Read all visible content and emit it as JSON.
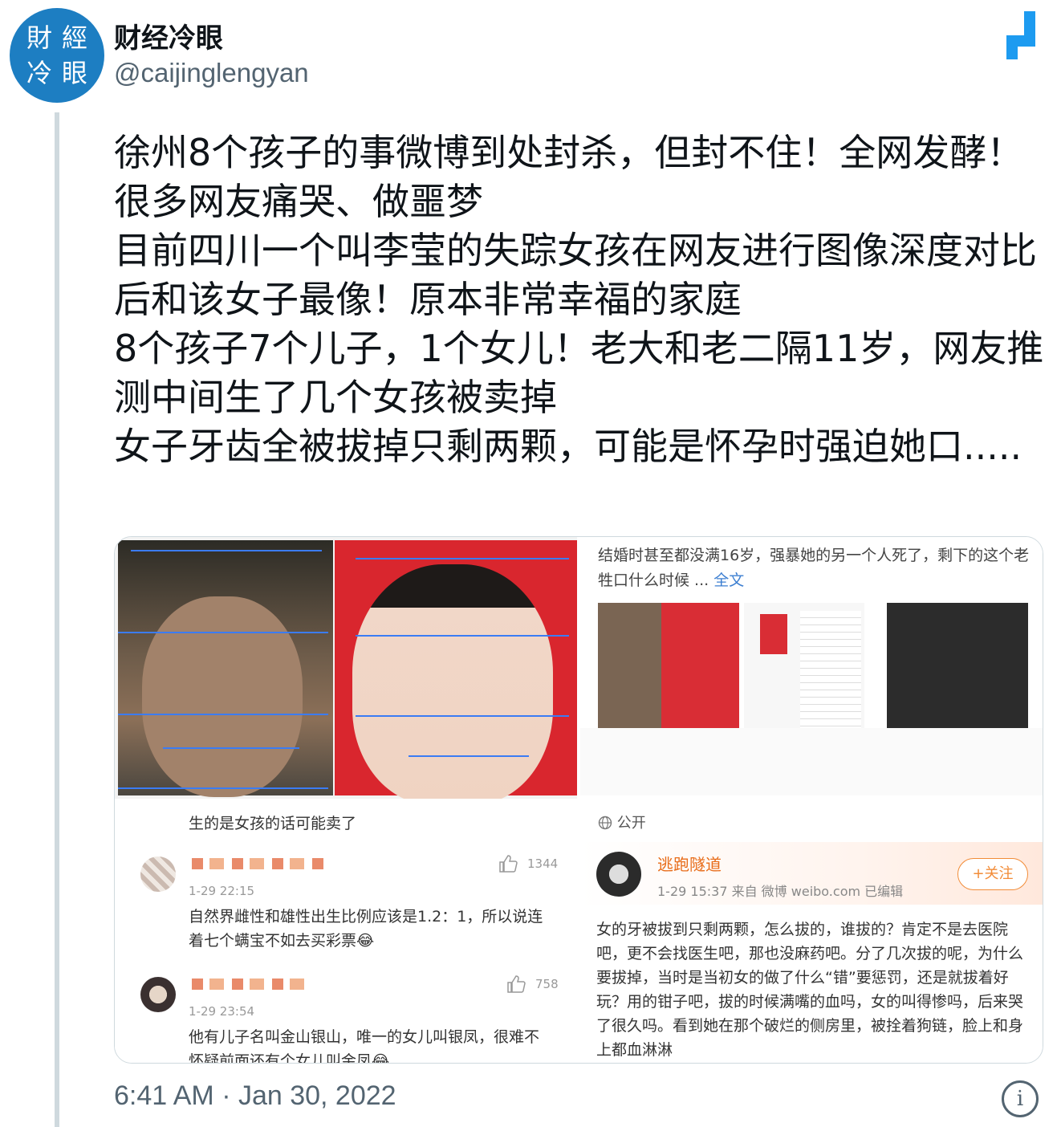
{
  "account": {
    "avatar_chars": [
      "財",
      "經",
      "冷",
      "眼"
    ],
    "display_name": "财经冷眼",
    "handle": "@caijinglengyan"
  },
  "tweet": {
    "lines": [
      "徐州8个孩子的事微博到处封杀，但封不住！全网发酵！很多网友痛哭、做噩梦",
      "目前四川一个叫李莹的失踪女孩在网友进行图像深度对比后和该女子最像！原本非常幸福的家庭",
      "8个孩子7个儿子，1个女儿！老大和老二隔11岁，网友推测中间生了几个女孩被卖掉",
      "女子牙齿全被拔掉只剩两颗，可能是怀孕时强迫她口....."
    ],
    "timestamp": "6:41 AM · Jan 30, 2022"
  },
  "media": {
    "left_comments": {
      "title": "生的是女孩的话可能卖了",
      "items": [
        {
          "time": "1-29 22:15",
          "likes": "1344",
          "text": "自然界雌性和雄性出生比例应该是1.2：1，所以说连着七个螨宝不如去买彩票😂"
        },
        {
          "time": "1-29 23:54",
          "likes": "758",
          "text": "他有儿子名叫金山银山，唯一的女儿叫银凤，很难不怀疑前面还有个女儿叫金凤😂"
        }
      ]
    },
    "right_top": {
      "text": "结婚时甚至都没满16岁，强暴她的另一个人死了，剩下的这个老牲口什么时候 ...",
      "more": "全文",
      "public_label": "公开"
    },
    "right_bottom": {
      "user": "逃跑隧道",
      "meta": "1-29 15:37  来自 微博 weibo.com  已编辑",
      "follow": "+关注",
      "text": "女的牙被拔到只剩两颗，怎么拔的，谁拔的？肯定不是去医院吧，更不会找医生吧，那也没麻药吧。分了几次拔的呢，为什么要拔掉，当时是当初女的做了什么“错”要惩罚，还是就拔着好玩？用的钳子吧，拔的时候满嘴的血吗，女的叫得惨吗，后来哭了很久吗。看到她在那个破烂的侧房里，被拴着狗链，脸上和身上都血淋淋"
    }
  },
  "icons": {
    "logo": "blog-logo-icon",
    "info": "info-icon",
    "like": "thumbs-up-icon",
    "globe": "globe-icon"
  },
  "colors": {
    "accent": "#1d7ec2",
    "link": "#3d7fd1",
    "muted": "#536471",
    "weibo_orange": "#e86c19"
  }
}
